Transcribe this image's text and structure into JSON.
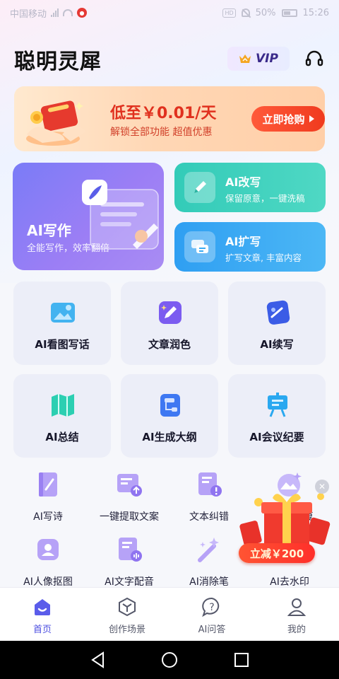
{
  "status_bar": {
    "carrier": "中国移动",
    "network": "4G",
    "battery": "50%",
    "time": "15:26"
  },
  "header": {
    "app_title": "聪明灵犀",
    "vip_label": "VIP"
  },
  "promo": {
    "price_text": "低至￥0.01/天",
    "subtitle": "解锁全部功能  超值优惠",
    "button_label": "立即抢购"
  },
  "features": {
    "write": {
      "title": "AI写作",
      "desc": "全能写作，效率翻倍"
    },
    "rewrite": {
      "title": "AI改写",
      "desc": "保留原意，一键洗稿"
    },
    "expand": {
      "title": "AI扩写",
      "desc": "扩写文章, 丰富内容"
    }
  },
  "tiles": [
    {
      "label": "AI看图写话",
      "icon": "picture-icon"
    },
    {
      "label": "文章润色",
      "icon": "sparkle-edit-icon"
    },
    {
      "label": "AI续写",
      "icon": "continue-write-icon"
    },
    {
      "label": "AI总结",
      "icon": "map-summary-icon"
    },
    {
      "label": "AI生成大纲",
      "icon": "outline-icon"
    },
    {
      "label": "AI会议纪要",
      "icon": "meeting-board-icon"
    }
  ],
  "tools": [
    {
      "label": "AI写诗",
      "icon": "poem-book-icon"
    },
    {
      "label": "一键提取文案",
      "icon": "extract-icon"
    },
    {
      "label": "文本纠错",
      "icon": "text-error-icon"
    },
    {
      "label": "修复",
      "icon": "photo-repair-icon"
    },
    {
      "label": "AI人像抠图",
      "icon": "portrait-cutout-icon"
    },
    {
      "label": "AI文字配音",
      "icon": "voice-icon"
    },
    {
      "label": "AI消除笔",
      "icon": "eraser-wand-icon"
    },
    {
      "label": "AI去水印",
      "icon": "watermark-icon"
    }
  ],
  "float_promo": {
    "tag": "立减￥200"
  },
  "tabbar": [
    {
      "label": "首页",
      "icon": "home-icon",
      "active": true
    },
    {
      "label": "创作场景",
      "icon": "cube-icon",
      "active": false
    },
    {
      "label": "AI问答",
      "icon": "question-bubble-icon",
      "active": false
    },
    {
      "label": "我的",
      "icon": "person-icon",
      "active": false
    }
  ],
  "colors": {
    "accent": "#4c4ee0",
    "promo_red": "#e0301e",
    "write_card": "#8a7cf6",
    "rewrite_card": "#3fd1bd",
    "expand_card": "#3aabf3"
  }
}
